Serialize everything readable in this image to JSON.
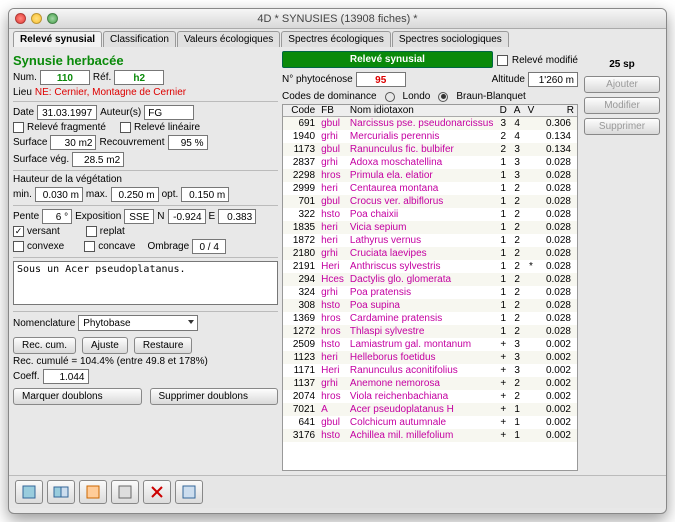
{
  "window_title": "4D * SYNUSIES (13908 fiches) *",
  "tabs": [
    "Relevé synusial",
    "Classification",
    "Valeurs écologiques",
    "Spectres écologiques",
    "Spectres sociologiques"
  ],
  "active_tab": 0,
  "releve_modifie_label": "Relevé modifié",
  "left": {
    "title": "Synusie herbacée",
    "num_label": "Num.",
    "num": "110",
    "ref_label": "Réf.",
    "ref": "h2",
    "lieu_label": "Lieu",
    "lieu": "NE: Cernier, Montagne de Cernier",
    "date_label": "Date",
    "date": "31.03.1997",
    "auteur_label": "Auteur(s)",
    "auteur": "FG",
    "releve_fragmente": "Relevé fragmenté",
    "releve_lineaire": "Relevé linéaire",
    "surface_label": "Surface",
    "surface": "30 m2",
    "recouvrement_label": "Recouvrement",
    "recouvrement": "95 %",
    "surface_veg_label": "Surface vég.",
    "surface_veg": "28.5 m2",
    "hauteur_label": "Hauteur de la végétation",
    "min_label": "min.",
    "min": "0.030 m",
    "max_label": "max.",
    "max": "0.250 m",
    "opt_label": "opt.",
    "opt": "0.150 m",
    "pente_label": "Pente",
    "pente": "6 °",
    "exposition_label": "Exposition",
    "exposition": "SSE",
    "n_label": "N",
    "n": "-0.924",
    "e_label": "E",
    "e": "0.383",
    "versant": "versant",
    "replat": "replat",
    "convexe": "convexe",
    "concave": "concave",
    "ombrage_label": "Ombrage",
    "ombrage": "0 / 4",
    "notes": "Sous un Acer pseudoplatanus.",
    "nomenclature_label": "Nomenclature",
    "nomenclature": "Phytobase",
    "btn_rec": "Rec. cum.",
    "btn_ajuste": "Ajuste",
    "btn_restaure": "Restaure",
    "rec_line": "Rec. cumulé = 104.4% (entre 49.8 et 178%)",
    "coeff_label": "Coeff.",
    "coeff": "1.044",
    "btn_marquer": "Marquer doublons",
    "btn_supprimer": "Supprimer doublons"
  },
  "right": {
    "banner": "Relevé synusial",
    "phyto_label": "N° phytocénose",
    "phyto": "95",
    "altitude_label": "Altitude",
    "altitude": "1'260 m",
    "codes_label": "Codes de dominance",
    "londo": "Londo",
    "braun": "Braun-Blanquet",
    "cols": [
      "Code",
      "FB",
      "Nom idiotaxon",
      "D",
      "A",
      "V",
      "R"
    ]
  },
  "side": {
    "count": "25 sp",
    "ajouter": "Ajouter",
    "modifier": "Modifier",
    "supprimer": "Supprimer"
  },
  "species": [
    {
      "code": "691",
      "fb": "gbul",
      "name": "Narcissus pse. pseudonarcissus",
      "d": "3",
      "a": "4",
      "v": "",
      "r": "0.306"
    },
    {
      "code": "1940",
      "fb": "grhi",
      "name": "Mercurialis perennis",
      "d": "2",
      "a": "4",
      "v": "",
      "r": "0.134"
    },
    {
      "code": "1173",
      "fb": "gbul",
      "name": "Ranunculus fic. bulbifer",
      "d": "2",
      "a": "3",
      "v": "",
      "r": "0.134"
    },
    {
      "code": "2837",
      "fb": "grhi",
      "name": "Adoxa moschatellina",
      "d": "1",
      "a": "3",
      "v": "",
      "r": "0.028"
    },
    {
      "code": "2298",
      "fb": "hros",
      "name": "Primula ela. elatior",
      "d": "1",
      "a": "3",
      "v": "",
      "r": "0.028"
    },
    {
      "code": "2999",
      "fb": "heri",
      "name": "Centaurea montana",
      "d": "1",
      "a": "2",
      "v": "",
      "r": "0.028"
    },
    {
      "code": "701",
      "fb": "gbul",
      "name": "Crocus ver. albiflorus",
      "d": "1",
      "a": "2",
      "v": "",
      "r": "0.028"
    },
    {
      "code": "322",
      "fb": "hsto",
      "name": "Poa chaixii",
      "d": "1",
      "a": "2",
      "v": "",
      "r": "0.028"
    },
    {
      "code": "1835",
      "fb": "heri",
      "name": "Vicia sepium",
      "d": "1",
      "a": "2",
      "v": "",
      "r": "0.028"
    },
    {
      "code": "1872",
      "fb": "heri",
      "name": "Lathyrus vernus",
      "d": "1",
      "a": "2",
      "v": "",
      "r": "0.028"
    },
    {
      "code": "2180",
      "fb": "grhi",
      "name": "Cruciata laevipes",
      "d": "1",
      "a": "2",
      "v": "",
      "r": "0.028"
    },
    {
      "code": "2191",
      "fb": "Heri",
      "name": "Anthriscus sylvestris",
      "d": "1",
      "a": "2",
      "v": "*",
      "r": "0.028"
    },
    {
      "code": "294",
      "fb": "Hces",
      "name": "Dactylis glo. glomerata",
      "d": "1",
      "a": "2",
      "v": "",
      "r": "0.028"
    },
    {
      "code": "324",
      "fb": "grhi",
      "name": "Poa pratensis",
      "d": "1",
      "a": "2",
      "v": "",
      "r": "0.028"
    },
    {
      "code": "308",
      "fb": "hsto",
      "name": "Poa supina",
      "d": "1",
      "a": "2",
      "v": "",
      "r": "0.028"
    },
    {
      "code": "1369",
      "fb": "hros",
      "name": "Cardamine pratensis",
      "d": "1",
      "a": "2",
      "v": "",
      "r": "0.028"
    },
    {
      "code": "1272",
      "fb": "hros",
      "name": "Thlaspi sylvestre",
      "d": "1",
      "a": "2",
      "v": "",
      "r": "0.028"
    },
    {
      "code": "2509",
      "fb": "hsto",
      "name": "Lamiastrum gal. montanum",
      "d": "+",
      "a": "3",
      "v": "",
      "r": "0.002"
    },
    {
      "code": "1123",
      "fb": "heri",
      "name": "Helleborus foetidus",
      "d": "+",
      "a": "3",
      "v": "",
      "r": "0.002"
    },
    {
      "code": "1171",
      "fb": "Heri",
      "name": "Ranunculus aconitifolius",
      "d": "+",
      "a": "3",
      "v": "",
      "r": "0.002"
    },
    {
      "code": "1137",
      "fb": "grhi",
      "name": "Anemone nemorosa",
      "d": "+",
      "a": "2",
      "v": "",
      "r": "0.002"
    },
    {
      "code": "2074",
      "fb": "hros",
      "name": "Viola reichenbachiana",
      "d": "+",
      "a": "2",
      "v": "",
      "r": "0.002"
    },
    {
      "code": "7021",
      "fb": "A",
      "name": "Acer pseudoplatanus H",
      "d": "+",
      "a": "1",
      "v": "",
      "r": "0.002"
    },
    {
      "code": "641",
      "fb": "gbul",
      "name": "Colchicum autumnale",
      "d": "+",
      "a": "1",
      "v": "",
      "r": "0.002"
    },
    {
      "code": "3176",
      "fb": "hsto",
      "name": "Achillea mil. millefolium",
      "d": "+",
      "a": "1",
      "v": "",
      "r": "0.002"
    }
  ]
}
